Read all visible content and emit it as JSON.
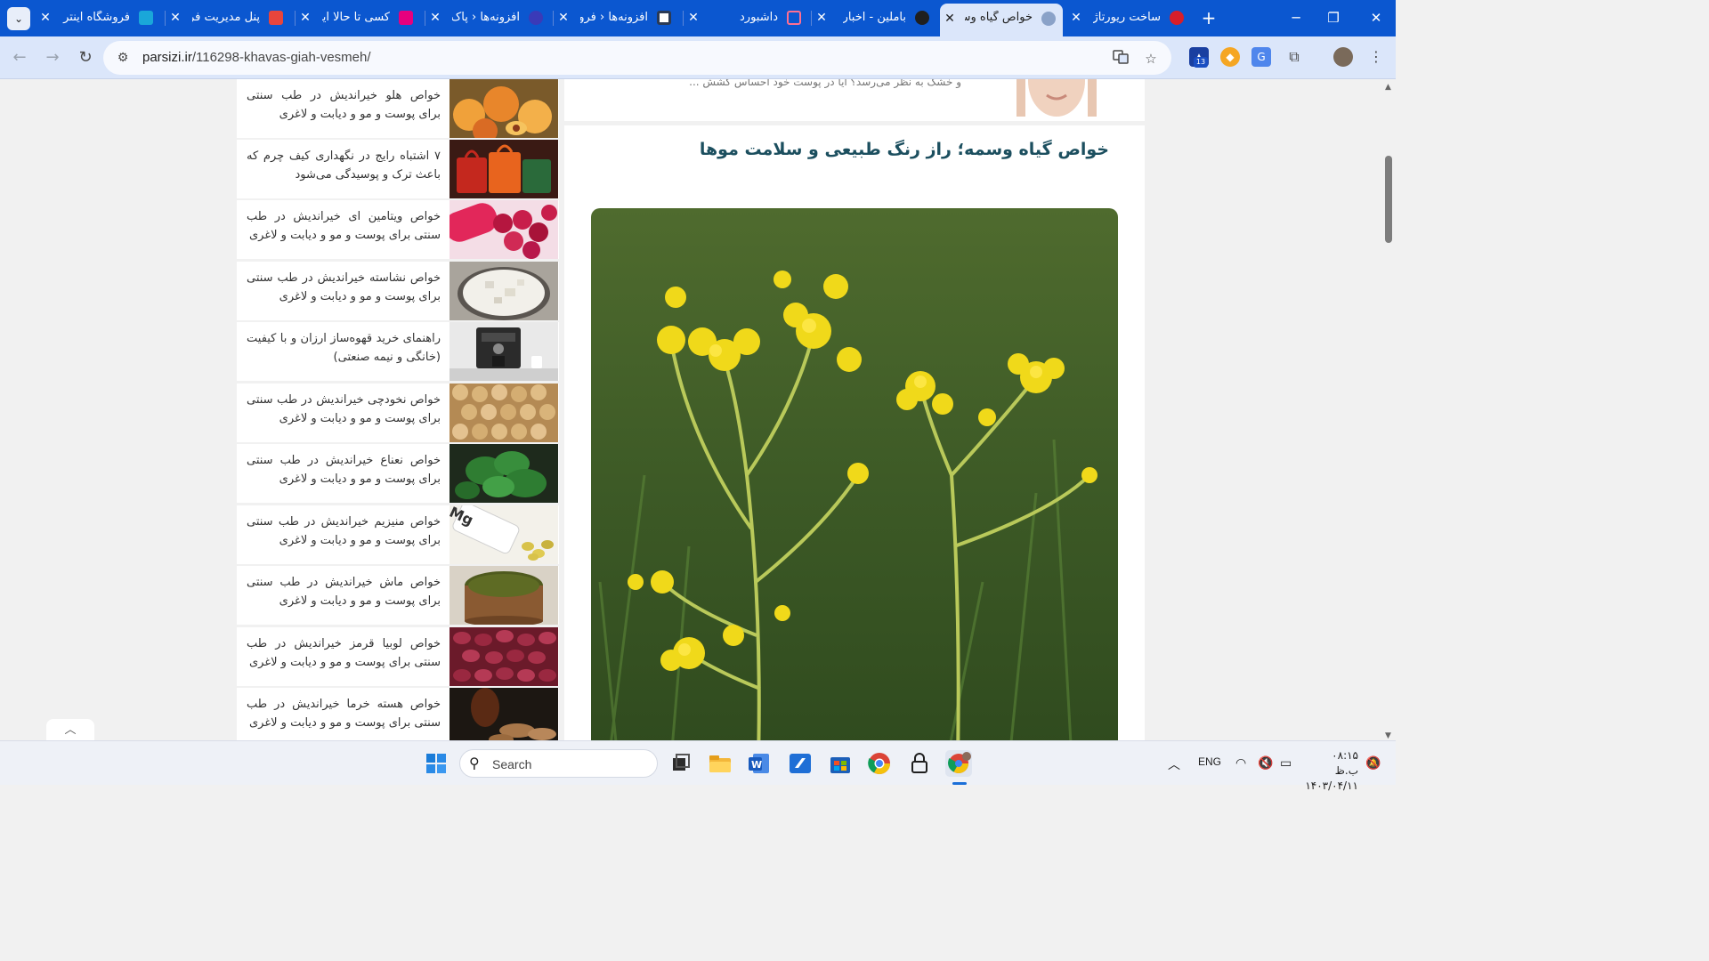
{
  "browser": {
    "tabs": [
      {
        "title": "فروشگاه اینترنت",
        "favicon_color": "#1aa7d9"
      },
      {
        "title": "پنل مدیریت فر",
        "favicon_color": "#e8453c"
      },
      {
        "title": "کسی تا حالا این",
        "favicon_color": "#e6007e"
      },
      {
        "title": "افزونه‌ها ‹ پاک",
        "favicon_color": "#3a3ab8"
      },
      {
        "title": "افزونه‌ها ‹ فرو",
        "favicon_color": "#2b3a55"
      },
      {
        "title": "داشبورد",
        "favicon_color": "#d6205a"
      },
      {
        "title": "باملین - اخبار",
        "favicon_color": "#1f1f1f"
      },
      {
        "title": "خواص گیاه وس",
        "favicon_color": "#8aa2c8",
        "active": true
      },
      {
        "title": "ساخت ریورتاژ",
        "favicon_color": "#d81e2a"
      }
    ],
    "close_glyph": "✕",
    "new_tab_glyph": "+",
    "tab_list_glyph": "⌄",
    "url_domain": "parsizi.ir",
    "url_path": "/116298-khavas-giah-vesmeh/",
    "extension_badge": "13"
  },
  "page": {
    "prev_excerpt": "و خشک به نظر می‌رسد؟ آیا در پوست خود احساس کشش ...",
    "article_title": "خواص گیاه وسمه؛ راز رنگ طبیعی و سلامت موها",
    "related": [
      {
        "title": "خواص هلو خیراندیش در طب سنتی برای پوست و مو و دیابت و لاغری",
        "thumb": "peach"
      },
      {
        "title": "۷ اشتباه رایج در نگهداری کیف چرم که باعث ترک و پوسیدگی می‌شود",
        "thumb": "bags"
      },
      {
        "title": "خواص ویتامین ای خیراندیش در طب سنتی برای پوست و مو و دیابت و لاغری",
        "thumb": "vitamin"
      },
      {
        "title": "خواص نشاسته خیراندیش در طب سنتی برای پوست و مو و دیابت و لاغری",
        "thumb": "starch"
      },
      {
        "title": "راهنمای خرید قهوه‌ساز ارزان و با کیفیت (خانگی و نیمه صنعتی)",
        "thumb": "coffee"
      },
      {
        "title": "خواص نخودچی خیراندیش در طب سنتی برای پوست و مو و دیابت و لاغری",
        "thumb": "chickpea"
      },
      {
        "title": "خواص نعناع خیراندیش در طب سنتی برای پوست و مو و دیابت و لاغری",
        "thumb": "mint"
      },
      {
        "title": "خواص منیزیم خیراندیش در طب سنتی برای پوست و مو و دیابت و لاغری",
        "thumb": "magnesium"
      },
      {
        "title": "خواص ماش خیراندیش در طب سنتی برای پوست و مو و دیابت و لاغری",
        "thumb": "mungbean"
      },
      {
        "title": "خواص لوبیا قرمز خیراندیش در طب سنتی برای پوست و مو و دیابت و لاغری",
        "thumb": "redbean"
      },
      {
        "title": "خواص هسته خرما خیراندیش در طب سنتی برای پوست و مو و دیابت و لاغری",
        "thumb": "dates"
      }
    ],
    "back_to_top_glyph": "︿"
  },
  "taskbar": {
    "search_placeholder": "Search",
    "language": "ENG",
    "time": "۰۸:۱۵ ب.ظ",
    "date": "۱۴۰۳/۰۴/۱۱"
  }
}
